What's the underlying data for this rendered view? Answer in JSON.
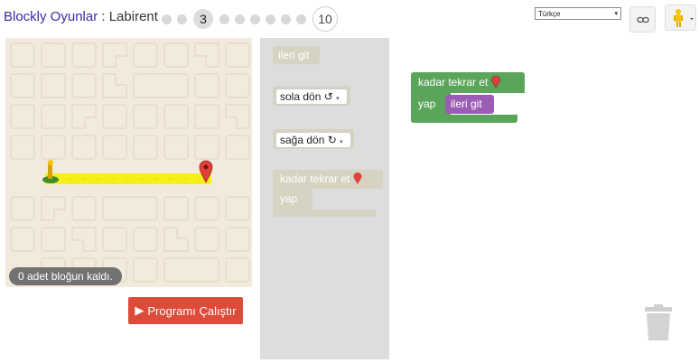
{
  "header": {
    "app_name": "Blockly Oyunlar",
    "separator": " : ",
    "game_name": "Labirent",
    "current_level": "3",
    "last_level": "10",
    "language_selected": "Türkçe",
    "dropdown_arrow": "▾"
  },
  "maze": {
    "remaining_blocks": "0 adet bloğun kaldı.",
    "run_button_icon": "▶",
    "run_button": "Programı Çalıştır"
  },
  "toolbox": {
    "move_forward": "ileri git",
    "turn_left": "sola dön ↺",
    "turn_right": "sağa dön ↻",
    "repeat_until": "kadar tekrar et",
    "do": "yap"
  },
  "workspace": {
    "repeat_until": "kadar tekrar et",
    "do": "yap",
    "move_forward": "ileri git"
  },
  "colors": {
    "loop_green": "#5ba55b",
    "action_purple": "#9a5cb4",
    "run_red": "#dd4b39",
    "path_yellow": "#f5ef1a",
    "toolbox_disabled": "#d6d3c2"
  },
  "icons": [
    "level-dot",
    "link-icon",
    "pegman-icon",
    "marker-icon",
    "play-icon",
    "trash-icon"
  ]
}
